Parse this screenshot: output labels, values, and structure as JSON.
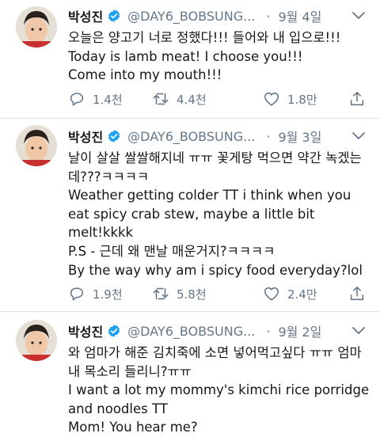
{
  "colors": {
    "text": "#14171a",
    "secondary": "#657786",
    "verified": "#1da1f2",
    "divider": "#e1e8ed"
  },
  "icons": {
    "verified": "verified-badge-icon",
    "reply": "reply-icon",
    "retweet": "retweet-icon",
    "like": "like-icon",
    "share": "share-icon",
    "more": "chevron-down-icon"
  },
  "tweets": [
    {
      "name": "박성진",
      "handle": "@DAY6_BOBSUNG...",
      "separator": "·",
      "date": "9월 4일",
      "lines": [
        "오늘은 양고기 너로 정했다!!! 들어와 내 입으로!!!",
        "Today is lamb meat! I choose you!!!",
        "Come into my mouth!!!"
      ],
      "replies": "1.4천",
      "retweets": "4.4천",
      "likes": "1.8만"
    },
    {
      "name": "박성진",
      "handle": "@DAY6_BOBSUNG...",
      "separator": "·",
      "date": "9월 3일",
      "lines": [
        "날이 살살 쌀쌀해지네 ㅠㅠ 꽃게탕 먹으면 약간 녹겠는",
        "데???ㅋㅋㅋㅋ",
        "Weather getting colder TT i think when you",
        "eat spicy crab stew, maybe a little bit",
        "melt!kkkk",
        "P.S - 근데 왜 맨날 매운거지?ㅋㅋㅋㅋ",
        "By the way why am i spicy food everyday?lol"
      ],
      "replies": "1.9천",
      "retweets": "5.8천",
      "likes": "2.4만"
    },
    {
      "name": "박성진",
      "handle": "@DAY6_BOBSUNG...",
      "separator": "·",
      "date": "9월 2일",
      "lines": [
        "와 엄마가 해준 김치죽에 소면 넣어먹고싶다 ㅠㅠ 엄마",
        "내 목소리 들리니?ㅠㅠ",
        "I want a lot my mommy's kimchi rice porridge",
        "and noodles TT",
        "Mom! You hear me?"
      ],
      "replies": "",
      "retweets": "",
      "likes": ""
    }
  ]
}
